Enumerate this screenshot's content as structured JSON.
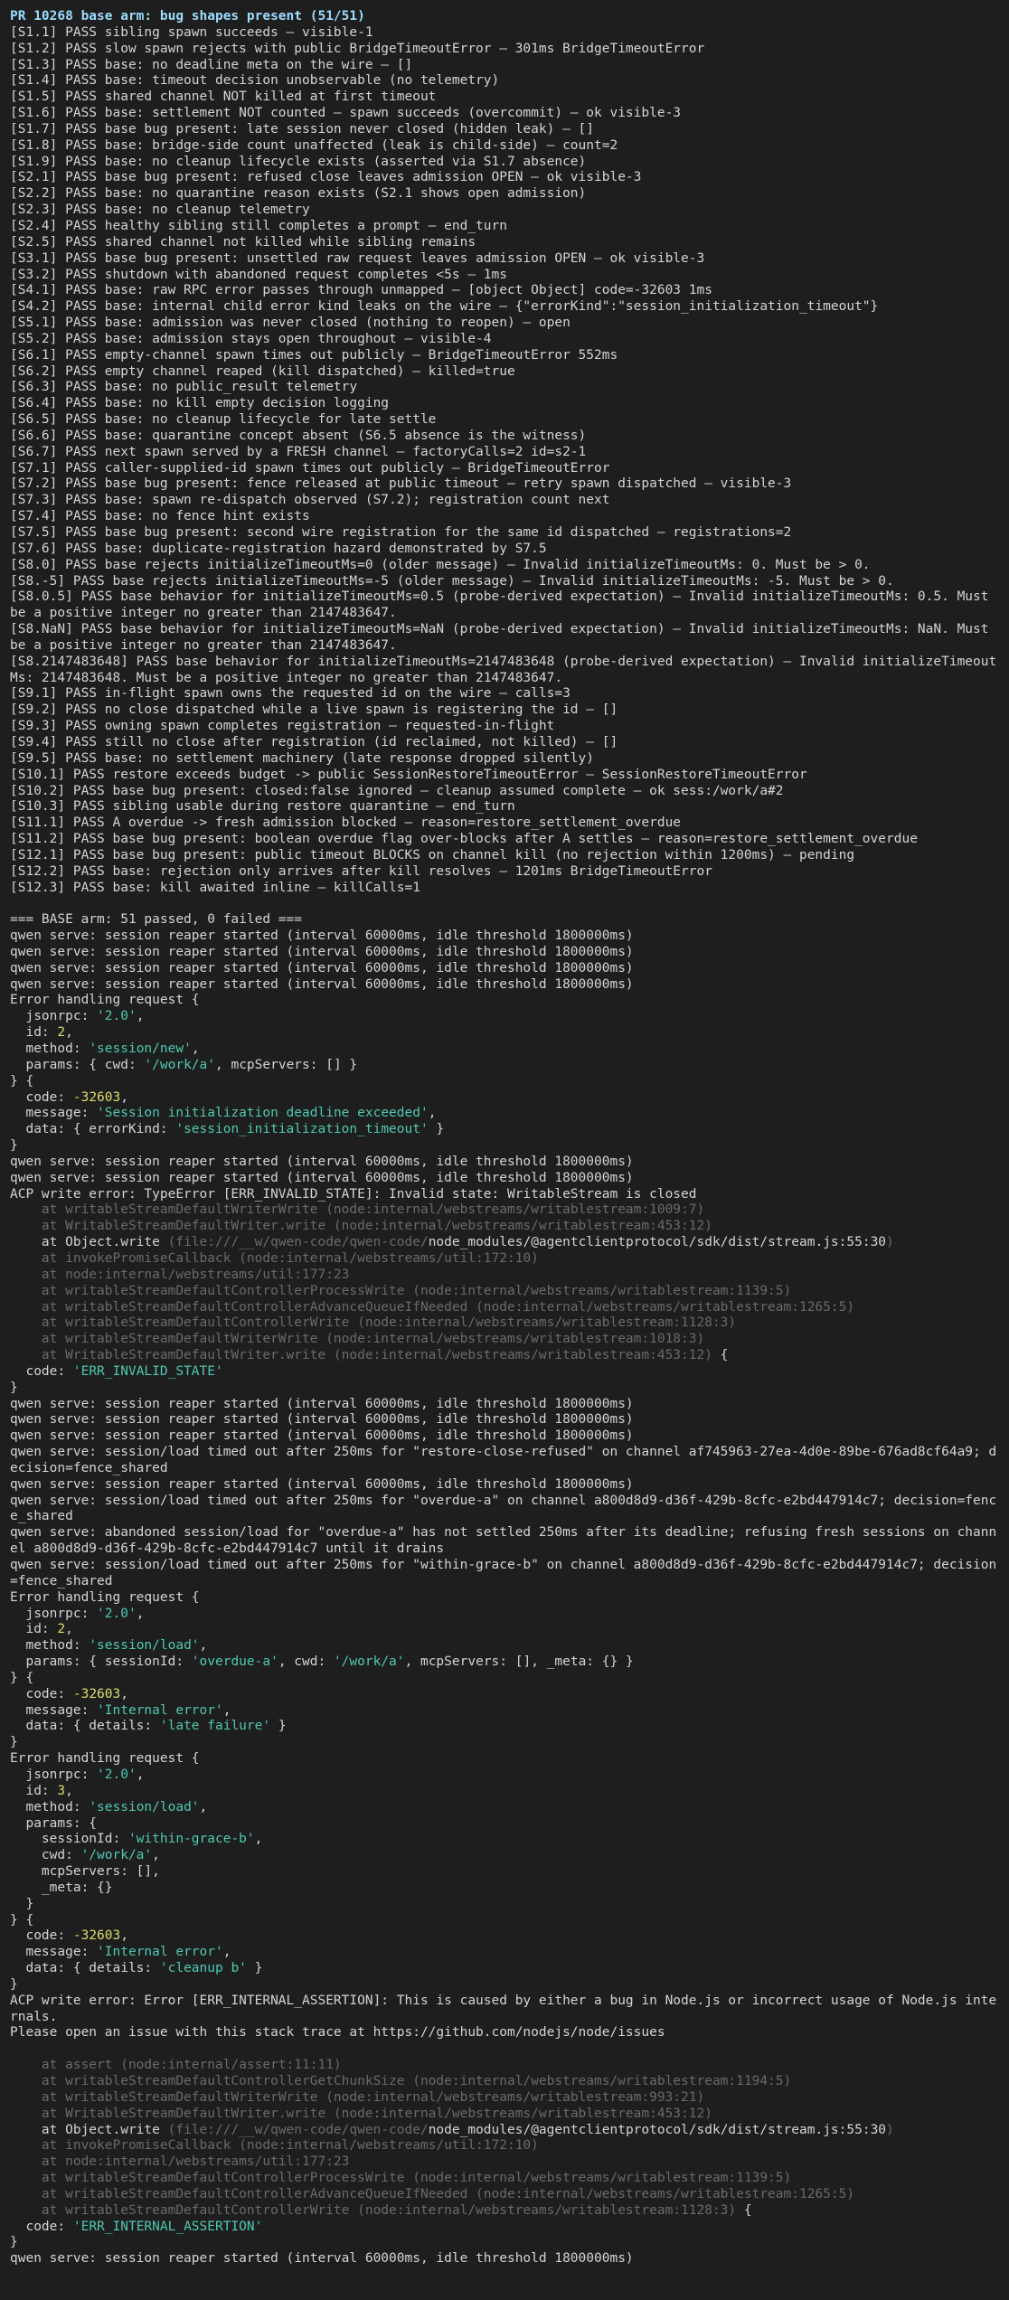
{
  "terminal": {
    "header": "PR 10268 base arm: bug shapes present (51/51)",
    "lines": [
      [
        {
          "t": "PR 10268 base arm: bug shapes present (51/51)",
          "c": "hdr"
        }
      ],
      [
        {
          "t": "[S1.1] PASS sibling spawn succeeds — visible-1"
        }
      ],
      [
        {
          "t": "[S1.2] PASS slow spawn rejects with public BridgeTimeoutError — 301ms BridgeTimeoutError"
        }
      ],
      [
        {
          "t": "[S1.3] PASS base: no deadline meta on the wire — []"
        }
      ],
      [
        {
          "t": "[S1.4] PASS base: timeout decision unobservable (no telemetry)"
        }
      ],
      [
        {
          "t": "[S1.5] PASS shared channel NOT killed at first timeout"
        }
      ],
      [
        {
          "t": "[S1.6] PASS base: settlement NOT counted — spawn succeeds (overcommit) — ok visible-3"
        }
      ],
      [
        {
          "t": "[S1.7] PASS base bug present: late session never closed (hidden leak) — []"
        }
      ],
      [
        {
          "t": "[S1.8] PASS base: bridge-side count unaffected (leak is child-side) — count=2"
        }
      ],
      [
        {
          "t": "[S1.9] PASS base: no cleanup lifecycle exists (asserted via S1.7 absence)"
        }
      ],
      [
        {
          "t": "[S2.1] PASS base bug present: refused close leaves admission OPEN — ok visible-3"
        }
      ],
      [
        {
          "t": "[S2.2] PASS base: no quarantine reason exists (S2.1 shows open admission)"
        }
      ],
      [
        {
          "t": "[S2.3] PASS base: no cleanup telemetry"
        }
      ],
      [
        {
          "t": "[S2.4] PASS healthy sibling still completes a prompt — end_turn"
        }
      ],
      [
        {
          "t": "[S2.5] PASS shared channel not killed while sibling remains"
        }
      ],
      [
        {
          "t": "[S3.1] PASS base bug present: unsettled raw request leaves admission OPEN — ok visible-3"
        }
      ],
      [
        {
          "t": "[S3.2] PASS shutdown with abandoned request completes <5s — 1ms"
        }
      ],
      [
        {
          "t": "[S4.1] PASS base: raw RPC error passes through unmapped — [object Object] code=-32603 1ms"
        }
      ],
      [
        {
          "t": "[S4.2] PASS base: internal child error kind leaks on the wire — {\"errorKind\":\"session_initialization_timeout\"}"
        }
      ],
      [
        {
          "t": "[S5.1] PASS base: admission was never closed (nothing to reopen) — open"
        }
      ],
      [
        {
          "t": "[S5.2] PASS base: admission stays open throughout — visible-4"
        }
      ],
      [
        {
          "t": "[S6.1] PASS empty-channel spawn times out publicly — BridgeTimeoutError 552ms"
        }
      ],
      [
        {
          "t": "[S6.2] PASS empty channel reaped (kill dispatched) — killed=true"
        }
      ],
      [
        {
          "t": "[S6.3] PASS base: no public_result telemetry"
        }
      ],
      [
        {
          "t": "[S6.4] PASS base: no kill empty decision logging"
        }
      ],
      [
        {
          "t": "[S6.5] PASS base: no cleanup lifecycle for late settle"
        }
      ],
      [
        {
          "t": "[S6.6] PASS base: quarantine concept absent (S6.5 absence is the witness)"
        }
      ],
      [
        {
          "t": "[S6.7] PASS next spawn served by a FRESH channel — factoryCalls=2 id=s2-1"
        }
      ],
      [
        {
          "t": "[S7.1] PASS caller-supplied-id spawn times out publicly — BridgeTimeoutError"
        }
      ],
      [
        {
          "t": "[S7.2] PASS base bug present: fence released at public timeout — retry spawn dispatched — visible-3"
        }
      ],
      [
        {
          "t": "[S7.3] PASS base: spawn re-dispatch observed (S7.2); registration count next"
        }
      ],
      [
        {
          "t": "[S7.4] PASS base: no fence hint exists"
        }
      ],
      [
        {
          "t": "[S7.5] PASS base bug present: second wire registration for the same id dispatched — registrations=2"
        }
      ],
      [
        {
          "t": "[S7.6] PASS base: duplicate-registration hazard demonstrated by S7.5"
        }
      ],
      [
        {
          "t": "[S8.0] PASS base rejects initializeTimeoutMs=0 (older message) — Invalid initializeTimeoutMs: 0. Must be > 0."
        }
      ],
      [
        {
          "t": "[S8.-5] PASS base rejects initializeTimeoutMs=-5 (older message) — Invalid initializeTimeoutMs: -5. Must be > 0."
        }
      ],
      [
        {
          "t": "[S8.0.5] PASS base behavior for initializeTimeoutMs=0.5 (probe-derived expectation) — Invalid initializeTimeoutMs: 0.5. Must be a positive integer no greater than 2147483647."
        }
      ],
      [
        {
          "t": "[S8.NaN] PASS base behavior for initializeTimeoutMs=NaN (probe-derived expectation) — Invalid initializeTimeoutMs: NaN. Must be a positive integer no greater than 2147483647."
        }
      ],
      [
        {
          "t": "[S8.2147483648] PASS base behavior for initializeTimeoutMs=2147483648 (probe-derived expectation) — Invalid initializeTimeoutMs: 2147483648. Must be a positive integer no greater than 2147483647."
        }
      ],
      [
        {
          "t": "[S9.1] PASS in-flight spawn owns the requested id on the wire — calls=3"
        }
      ],
      [
        {
          "t": "[S9.2] PASS no close dispatched while a live spawn is registering the id — []"
        }
      ],
      [
        {
          "t": "[S9.3] PASS owning spawn completes registration — requested-in-flight"
        }
      ],
      [
        {
          "t": "[S9.4] PASS still no close after registration (id reclaimed, not killed) — []"
        }
      ],
      [
        {
          "t": "[S9.5] PASS base: no settlement machinery (late response dropped silently)"
        }
      ],
      [
        {
          "t": "[S10.1] PASS restore exceeds budget -> public SessionRestoreTimeoutError — SessionRestoreTimeoutError"
        }
      ],
      [
        {
          "t": "[S10.2] PASS base bug present: closed:false ignored — cleanup assumed complete — ok sess:/work/a#2"
        }
      ],
      [
        {
          "t": "[S10.3] PASS sibling usable during restore quarantine — end_turn"
        }
      ],
      [
        {
          "t": "[S11.1] PASS A overdue -> fresh admission blocked — reason=restore_settlement_overdue"
        }
      ],
      [
        {
          "t": "[S11.2] PASS base bug present: boolean overdue flag over-blocks after A settles — reason=restore_settlement_overdue"
        }
      ],
      [
        {
          "t": "[S12.1] PASS base bug present: public timeout BLOCKS on channel kill (no rejection within 1200ms) — pending"
        }
      ],
      [
        {
          "t": "[S12.2] PASS base: rejection only arrives after kill resolves — 1201ms BridgeTimeoutError"
        }
      ],
      [
        {
          "t": "[S12.3] PASS base: kill awaited inline — killCalls=1"
        }
      ],
      [
        {
          "t": ""
        }
      ],
      [
        {
          "t": "=== BASE arm: 51 passed, 0 failed ==="
        }
      ],
      [
        {
          "t": "qwen serve: session reaper started (interval 60000ms, idle threshold 1800000ms)"
        }
      ],
      [
        {
          "t": "qwen serve: session reaper started (interval 60000ms, idle threshold 1800000ms)"
        }
      ],
      [
        {
          "t": "qwen serve: session reaper started (interval 60000ms, idle threshold 1800000ms)"
        }
      ],
      [
        {
          "t": "qwen serve: session reaper started (interval 60000ms, idle threshold 1800000ms)"
        }
      ],
      [
        {
          "t": "Error handling request {"
        }
      ],
      [
        {
          "t": "  jsonrpc: "
        },
        {
          "t": "'2.0'",
          "c": "str"
        },
        {
          "t": ","
        }
      ],
      [
        {
          "t": "  id: "
        },
        {
          "t": "2",
          "c": "num"
        },
        {
          "t": ","
        }
      ],
      [
        {
          "t": "  method: "
        },
        {
          "t": "'session/new'",
          "c": "str"
        },
        {
          "t": ","
        }
      ],
      [
        {
          "t": "  params: { cwd: "
        },
        {
          "t": "'/work/a'",
          "c": "str"
        },
        {
          "t": ", mcpServers: [] }"
        }
      ],
      [
        {
          "t": "} {"
        }
      ],
      [
        {
          "t": "  code: "
        },
        {
          "t": "-32603",
          "c": "num"
        },
        {
          "t": ","
        }
      ],
      [
        {
          "t": "  message: "
        },
        {
          "t": "'Session initialization deadline exceeded'",
          "c": "str"
        },
        {
          "t": ","
        }
      ],
      [
        {
          "t": "  data: { errorKind: "
        },
        {
          "t": "'session_initialization_timeout'",
          "c": "str"
        },
        {
          "t": " }"
        }
      ],
      [
        {
          "t": "}"
        }
      ],
      [
        {
          "t": "qwen serve: session reaper started (interval 60000ms, idle threshold 1800000ms)"
        }
      ],
      [
        {
          "t": "qwen serve: session reaper started (interval 60000ms, idle threshold 1800000ms)"
        }
      ],
      [
        {
          "t": "ACP write error: TypeError [ERR_INVALID_STATE]: Invalid state: WritableStream is closed"
        }
      ],
      [
        {
          "t": "    at writableStreamDefaultWriterWrite (node:internal/webstreams/writablestream:1009:7)",
          "c": "dim"
        }
      ],
      [
        {
          "t": "    at WritableStreamDefaultWriter.write (node:internal/webstreams/writablestream:453:12)",
          "c": "dim"
        }
      ],
      [
        {
          "t": "    at Object.write "
        },
        {
          "t": "(file:///__w/qwen-code/qwen-code/",
          "c": "dim"
        },
        {
          "t": "node_modules/@agentclientprotocol/sdk/dist/stream.js:55:30"
        },
        {
          "t": ")",
          "c": "dim"
        }
      ],
      [
        {
          "t": "    at invokePromiseCallback (node:internal/webstreams/util:172:10)",
          "c": "dim"
        }
      ],
      [
        {
          "t": "    at node:internal/webstreams/util:177:23",
          "c": "dim"
        }
      ],
      [
        {
          "t": "    at writableStreamDefaultControllerProcessWrite (node:internal/webstreams/writablestream:1139:5)",
          "c": "dim"
        }
      ],
      [
        {
          "t": "    at writableStreamDefaultControllerAdvanceQueueIfNeeded (node:internal/webstreams/writablestream:1265:5)",
          "c": "dim"
        }
      ],
      [
        {
          "t": "    at writableStreamDefaultControllerWrite (node:internal/webstreams/writablestream:1128:3)",
          "c": "dim"
        }
      ],
      [
        {
          "t": "    at writableStreamDefaultWriterWrite (node:internal/webstreams/writablestream:1018:3)",
          "c": "dim"
        }
      ],
      [
        {
          "t": "    at WritableStreamDefaultWriter.write (node:internal/webstreams/writablestream:453:12)",
          "c": "dim"
        },
        {
          "t": " {"
        }
      ],
      [
        {
          "t": "  code: "
        },
        {
          "t": "'ERR_INVALID_STATE'",
          "c": "str"
        }
      ],
      [
        {
          "t": "}"
        }
      ],
      [
        {
          "t": "qwen serve: session reaper started (interval 60000ms, idle threshold 1800000ms)"
        }
      ],
      [
        {
          "t": "qwen serve: session reaper started (interval 60000ms, idle threshold 1800000ms)"
        }
      ],
      [
        {
          "t": "qwen serve: session reaper started (interval 60000ms, idle threshold 1800000ms)"
        }
      ],
      [
        {
          "t": "qwen serve: session/load timed out after 250ms for \"restore-close-refused\" on channel af745963-27ea-4d0e-89be-676ad8cf64a9; decision=fence_shared"
        }
      ],
      [
        {
          "t": "qwen serve: session reaper started (interval 60000ms, idle threshold 1800000ms)"
        }
      ],
      [
        {
          "t": "qwen serve: session/load timed out after 250ms for \"overdue-a\" on channel a800d8d9-d36f-429b-8cfc-e2bd447914c7; decision=fence_shared"
        }
      ],
      [
        {
          "t": "qwen serve: abandoned session/load for \"overdue-a\" has not settled 250ms after its deadline; refusing fresh sessions on channel a800d8d9-d36f-429b-8cfc-e2bd447914c7 until it drains"
        }
      ],
      [
        {
          "t": "qwen serve: session/load timed out after 250ms for \"within-grace-b\" on channel a800d8d9-d36f-429b-8cfc-e2bd447914c7; decision=fence_shared"
        }
      ],
      [
        {
          "t": "Error handling request {"
        }
      ],
      [
        {
          "t": "  jsonrpc: "
        },
        {
          "t": "'2.0'",
          "c": "str"
        },
        {
          "t": ","
        }
      ],
      [
        {
          "t": "  id: "
        },
        {
          "t": "2",
          "c": "num"
        },
        {
          "t": ","
        }
      ],
      [
        {
          "t": "  method: "
        },
        {
          "t": "'session/load'",
          "c": "str"
        },
        {
          "t": ","
        }
      ],
      [
        {
          "t": "  params: { sessionId: "
        },
        {
          "t": "'overdue-a'",
          "c": "str"
        },
        {
          "t": ", cwd: "
        },
        {
          "t": "'/work/a'",
          "c": "str"
        },
        {
          "t": ", mcpServers: [], _meta: {} }"
        }
      ],
      [
        {
          "t": "} {"
        }
      ],
      [
        {
          "t": "  code: "
        },
        {
          "t": "-32603",
          "c": "num"
        },
        {
          "t": ","
        }
      ],
      [
        {
          "t": "  message: "
        },
        {
          "t": "'Internal error'",
          "c": "str"
        },
        {
          "t": ","
        }
      ],
      [
        {
          "t": "  data: { details: "
        },
        {
          "t": "'late failure'",
          "c": "str"
        },
        {
          "t": " }"
        }
      ],
      [
        {
          "t": "}"
        }
      ],
      [
        {
          "t": "Error handling request {"
        }
      ],
      [
        {
          "t": "  jsonrpc: "
        },
        {
          "t": "'2.0'",
          "c": "str"
        },
        {
          "t": ","
        }
      ],
      [
        {
          "t": "  id: "
        },
        {
          "t": "3",
          "c": "num"
        },
        {
          "t": ","
        }
      ],
      [
        {
          "t": "  method: "
        },
        {
          "t": "'session/load'",
          "c": "str"
        },
        {
          "t": ","
        }
      ],
      [
        {
          "t": "  params: {"
        }
      ],
      [
        {
          "t": "    sessionId: "
        },
        {
          "t": "'within-grace-b'",
          "c": "str"
        },
        {
          "t": ","
        }
      ],
      [
        {
          "t": "    cwd: "
        },
        {
          "t": "'/work/a'",
          "c": "str"
        },
        {
          "t": ","
        }
      ],
      [
        {
          "t": "    mcpServers: [],"
        }
      ],
      [
        {
          "t": "    _meta: {}"
        }
      ],
      [
        {
          "t": "  }"
        }
      ],
      [
        {
          "t": "} {"
        }
      ],
      [
        {
          "t": "  code: "
        },
        {
          "t": "-32603",
          "c": "num"
        },
        {
          "t": ","
        }
      ],
      [
        {
          "t": "  message: "
        },
        {
          "t": "'Internal error'",
          "c": "str"
        },
        {
          "t": ","
        }
      ],
      [
        {
          "t": "  data: { details: "
        },
        {
          "t": "'cleanup b'",
          "c": "str"
        },
        {
          "t": " }"
        }
      ],
      [
        {
          "t": "}"
        }
      ],
      [
        {
          "t": "ACP write error: Error [ERR_INTERNAL_ASSERTION]: This is caused by either a bug in Node.js or incorrect usage of Node.js internals."
        }
      ],
      [
        {
          "t": "Please open an issue with this stack trace at https://github.com/nodejs/node/issues"
        }
      ],
      [
        {
          "t": ""
        }
      ],
      [
        {
          "t": "    at assert (node:internal/assert:11:11)",
          "c": "dim"
        }
      ],
      [
        {
          "t": "    at writableStreamDefaultControllerGetChunkSize (node:internal/webstreams/writablestream:1194:5)",
          "c": "dim"
        }
      ],
      [
        {
          "t": "    at writableStreamDefaultWriterWrite (node:internal/webstreams/writablestream:993:21)",
          "c": "dim"
        }
      ],
      [
        {
          "t": "    at WritableStreamDefaultWriter.write (node:internal/webstreams/writablestream:453:12)",
          "c": "dim"
        }
      ],
      [
        {
          "t": "    at Object.write "
        },
        {
          "t": "(file:///__w/qwen-code/qwen-code/",
          "c": "dim"
        },
        {
          "t": "node_modules/@agentclientprotocol/sdk/dist/stream.js:55:30"
        },
        {
          "t": ")",
          "c": "dim"
        }
      ],
      [
        {
          "t": "    at invokePromiseCallback (node:internal/webstreams/util:172:10)",
          "c": "dim"
        }
      ],
      [
        {
          "t": "    at node:internal/webstreams/util:177:23",
          "c": "dim"
        }
      ],
      [
        {
          "t": "    at writableStreamDefaultControllerProcessWrite (node:internal/webstreams/writablestream:1139:5)",
          "c": "dim"
        }
      ],
      [
        {
          "t": "    at writableStreamDefaultControllerAdvanceQueueIfNeeded (node:internal/webstreams/writablestream:1265:5)",
          "c": "dim"
        }
      ],
      [
        {
          "t": "    at writableStreamDefaultControllerWrite (node:internal/webstreams/writablestream:1128:3)",
          "c": "dim"
        },
        {
          "t": " {"
        }
      ],
      [
        {
          "t": "  code: "
        },
        {
          "t": "'ERR_INTERNAL_ASSERTION'",
          "c": "str"
        }
      ],
      [
        {
          "t": "}"
        }
      ],
      [
        {
          "t": "qwen serve: session reaper started (interval 60000ms, idle threshold 1800000ms)"
        }
      ]
    ]
  }
}
